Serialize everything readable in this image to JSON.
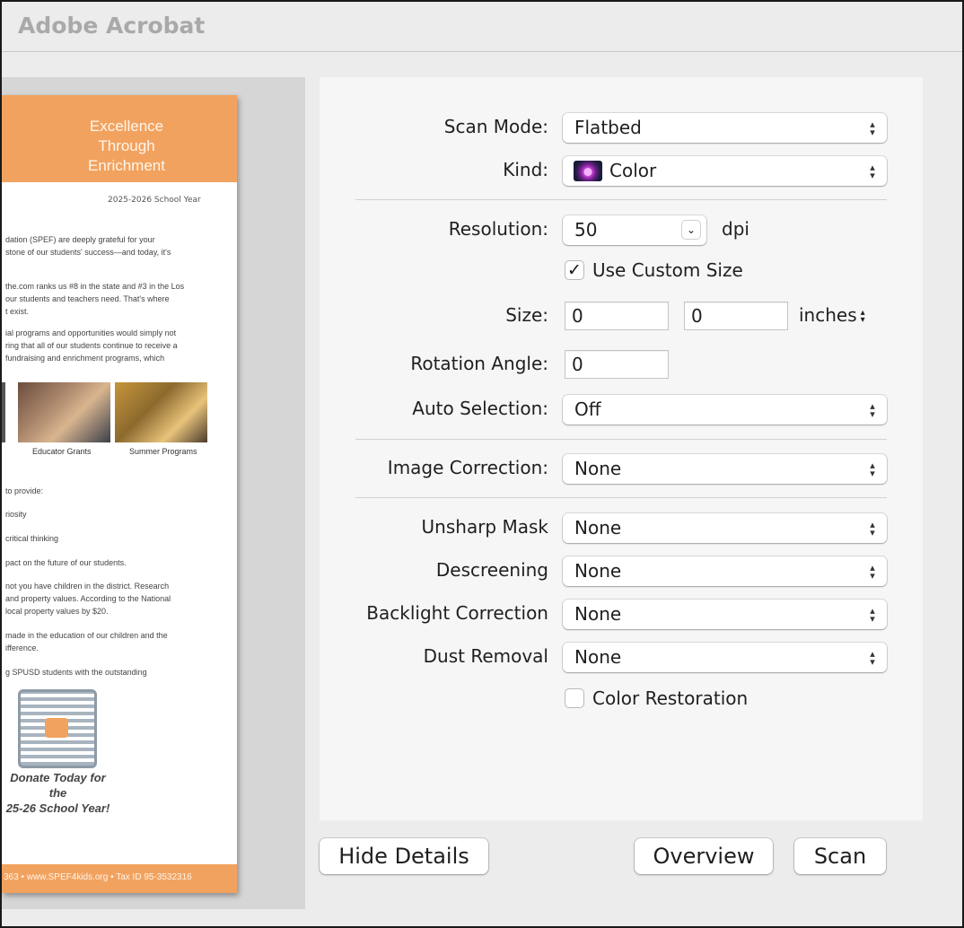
{
  "window": {
    "title": "Adobe Acrobat"
  },
  "preview": {
    "doc_title_lines": [
      "Excellence",
      "Through",
      "Enrichment"
    ],
    "doc_subtitle": "2025-2026 School Year",
    "doc_lines": [
      "dation (SPEF) are deeply grateful for your",
      "stone of our students' success—and today, it's",
      "the.com ranks us #8 in the state and #3 in the Los",
      "our students and teachers need. That's where",
      "t exist.",
      "ial programs and opportunities would simply not",
      "ring that all of our students continue to receive a",
      "fundraising and enrichment programs, which",
      "to provide:",
      "riosity",
      "critical thinking",
      "pact on the future of our students.",
      "not you have children in the district. Research",
      "and property values. According to the National",
      "local property values by $20.",
      "made in the education of our children and the",
      "ifference.",
      "g SPUSD students with the outstanding"
    ],
    "photo_captions": [
      "Educator Grants",
      "Summer Programs"
    ],
    "donate_lines": [
      "Donate Today for the",
      "25-26 School Year!"
    ],
    "footer": "363 • www.SPEF4kids.org • Tax ID 95-3532316"
  },
  "settings": {
    "scan_mode": {
      "label": "Scan Mode:",
      "value": "Flatbed"
    },
    "kind": {
      "label": "Kind:",
      "value": "Color"
    },
    "resolution": {
      "label": "Resolution:",
      "value": "50",
      "unit": "dpi"
    },
    "use_custom_size": {
      "label": "Use Custom Size",
      "checked": "✓"
    },
    "size": {
      "label": "Size:",
      "width": "0",
      "height": "0",
      "unit": "inches"
    },
    "rotation_angle": {
      "label": "Rotation Angle:",
      "value": "0"
    },
    "auto_selection": {
      "label": "Auto Selection:",
      "value": "Off"
    },
    "image_correction": {
      "label": "Image Correction:",
      "value": "None"
    },
    "unsharp_mask": {
      "label": "Unsharp Mask",
      "value": "None"
    },
    "descreening": {
      "label": "Descreening",
      "value": "None"
    },
    "backlight_correction": {
      "label": "Backlight Correction",
      "value": "None"
    },
    "dust_removal": {
      "label": "Dust Removal",
      "value": "None"
    },
    "color_restoration": {
      "label": "Color Restoration"
    }
  },
  "buttons": {
    "hide_details": "Hide Details",
    "overview": "Overview",
    "scan": "Scan"
  }
}
